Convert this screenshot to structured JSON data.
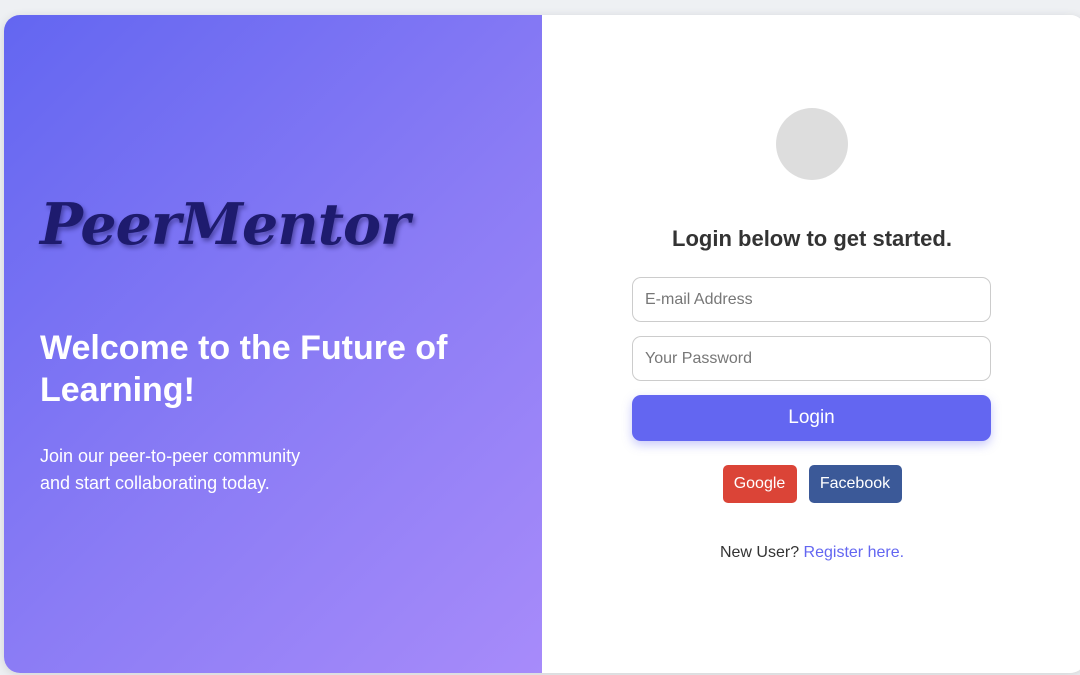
{
  "brand": {
    "name": "PeerMentor"
  },
  "hero": {
    "heading": "Welcome to the Future of Learning!",
    "subtext_line1": "Join our peer-to-peer community",
    "subtext_line2": "and start collaborating today."
  },
  "login": {
    "title": "Login below to get started.",
    "email_placeholder": "E-mail Address",
    "password_placeholder": "Your Password",
    "login_label": "Login",
    "google_label": "Google",
    "facebook_label": "Facebook",
    "new_user_text": "New User?",
    "register_label": "Register here."
  },
  "colors": {
    "accent": "#6366f1",
    "google": "#db4437",
    "facebook": "#3b5998",
    "brand_text": "#1e1b6e"
  },
  "icons": {
    "avatar": "avatar-placeholder"
  }
}
